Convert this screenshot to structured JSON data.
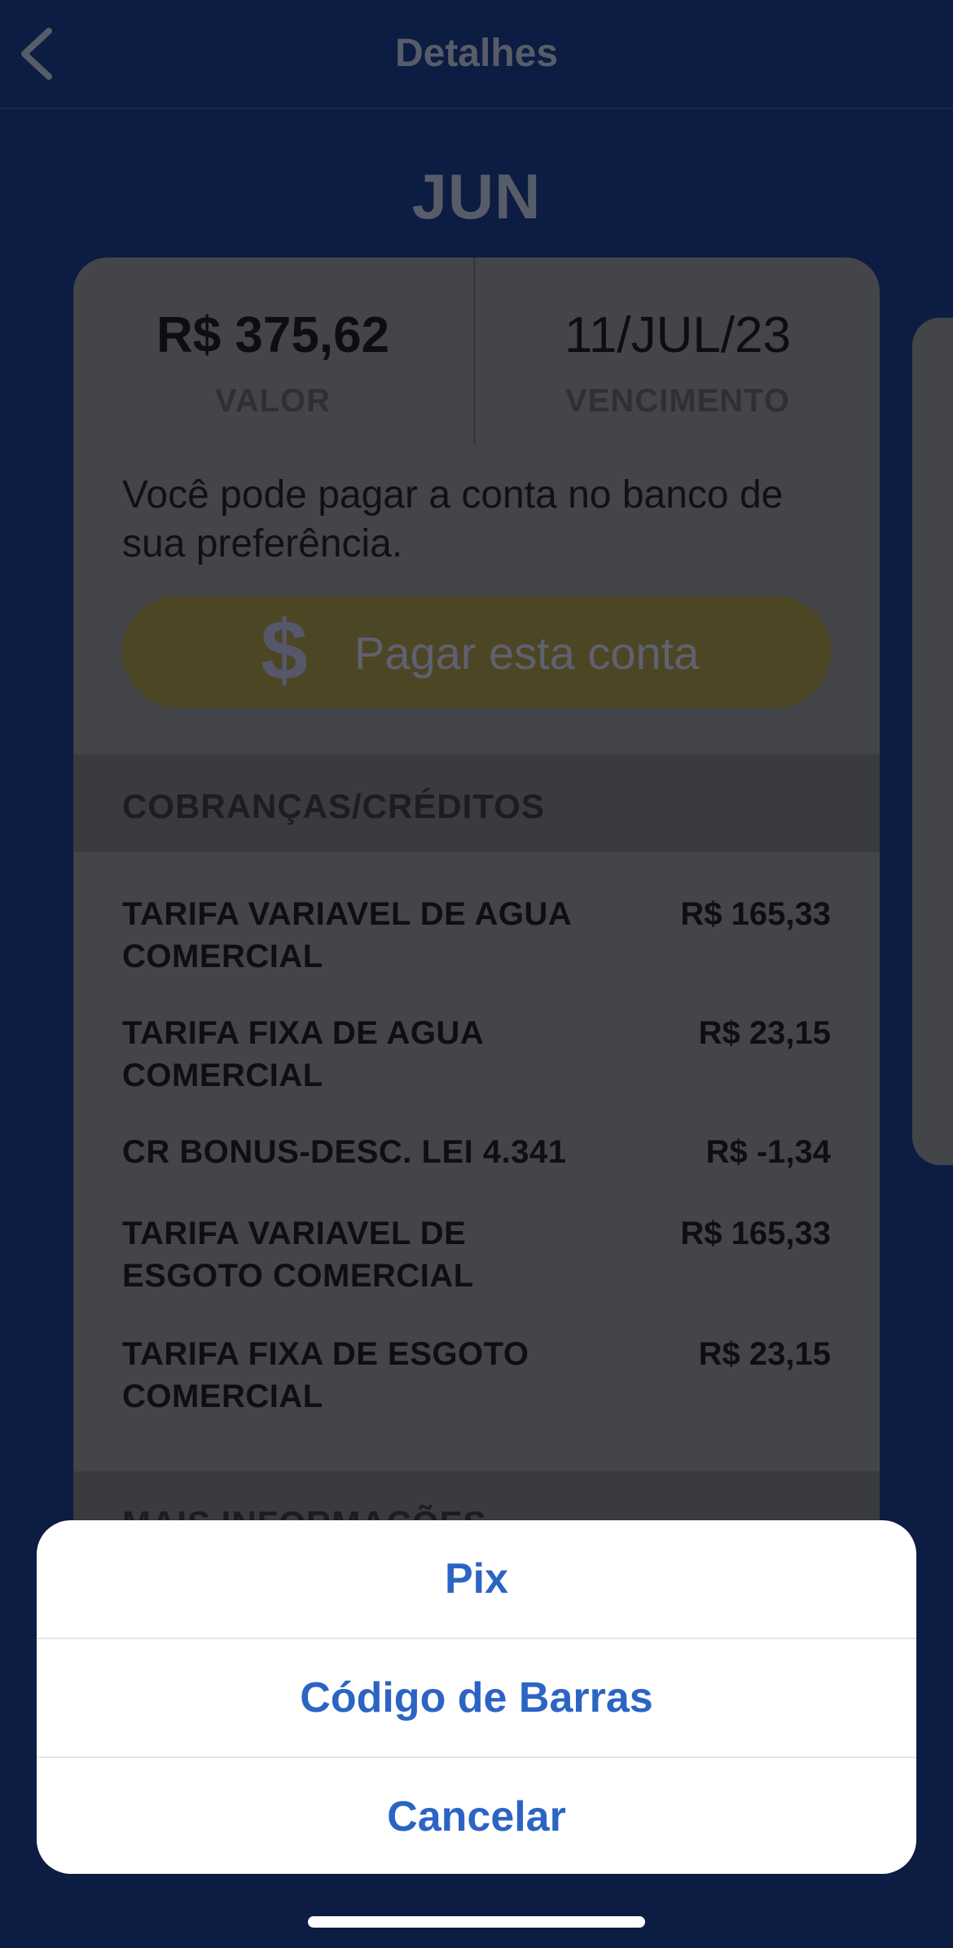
{
  "nav": {
    "title": "Detalhes",
    "back_icon": "chevron-left-icon"
  },
  "bill": {
    "month": "JUN",
    "amount": "R$ 375,62",
    "amount_label": "VALOR",
    "due_date": "11/JUL/23",
    "due_label": "VENCIMENTO",
    "pay_text": "Você pode pagar a conta no banco de sua preferência.",
    "pay_button": {
      "icon": "$",
      "label": "Pagar esta conta"
    }
  },
  "charges_section": {
    "title": "COBRANÇAS/CRÉDITOS",
    "items": [
      {
        "name": "TARIFA VARIAVEL DE AGUA COMERCIAL",
        "value": "R$ 165,33"
      },
      {
        "name": "TARIFA FIXA DE AGUA COMERCIAL",
        "value": "R$ 23,15"
      },
      {
        "name": "CR BONUS-DESC. LEI 4.341",
        "value": "R$ -1,34"
      },
      {
        "name": "TARIFA VARIAVEL DE ESGOTO COMERCIAL",
        "value": "R$ 165,33"
      },
      {
        "name": "TARIFA FIXA DE ESGOTO COMERCIAL",
        "value": "R$ 23,15"
      }
    ]
  },
  "more_section": {
    "title": "MAIS INFORMAÇÕES"
  },
  "action_sheet": {
    "pix": "Pix",
    "barcode": "Código de Barras",
    "cancel": "Cancelar"
  },
  "colors": {
    "background": "#0c1c42",
    "card": "#444548",
    "accent_link": "#2c64c4",
    "pay_button": "#4c4625"
  }
}
